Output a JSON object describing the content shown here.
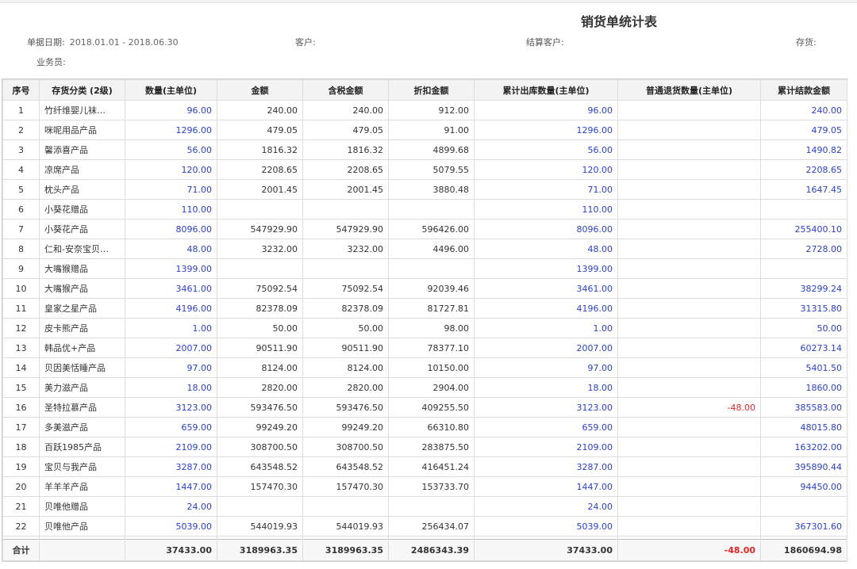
{
  "title": "销货单统计表",
  "filters": {
    "date_label": "单据日期:",
    "date_value": "2018.01.01 - 2018.06.30",
    "customer_label": "客户:",
    "settle_customer_label": "结算客户:",
    "inventory_label": "存货:",
    "salesperson_label": "业务员:"
  },
  "columns": [
    "序号",
    "存货分类 (2级)",
    "数量(主单位)",
    "金额",
    "含税金额",
    "折扣金额",
    "累计出库数量(主单位)",
    "普通退货数量(主单位)",
    "累计结款金额"
  ],
  "rows": [
    {
      "seq": "1",
      "category": "竹纤维婴儿袜…",
      "qty": "96.00",
      "amount": "240.00",
      "tax_amount": "240.00",
      "discount": "912.00",
      "out_qty": "96.00",
      "return_qty": "",
      "settled": "240.00"
    },
    {
      "seq": "2",
      "category": "咪呢用品产品",
      "qty": "1296.00",
      "amount": "479.05",
      "tax_amount": "479.05",
      "discount": "91.00",
      "out_qty": "1296.00",
      "return_qty": "",
      "settled": "479.05"
    },
    {
      "seq": "3",
      "category": "馨添喜产品",
      "qty": "56.00",
      "amount": "1816.32",
      "tax_amount": "1816.32",
      "discount": "4899.68",
      "out_qty": "56.00",
      "return_qty": "",
      "settled": "1490.82"
    },
    {
      "seq": "4",
      "category": "凉席产品",
      "qty": "120.00",
      "amount": "2208.65",
      "tax_amount": "2208.65",
      "discount": "5079.55",
      "out_qty": "120.00",
      "return_qty": "",
      "settled": "2208.65"
    },
    {
      "seq": "5",
      "category": "枕头产品",
      "qty": "71.00",
      "amount": "2001.45",
      "tax_amount": "2001.45",
      "discount": "3880.48",
      "out_qty": "71.00",
      "return_qty": "",
      "settled": "1647.45"
    },
    {
      "seq": "6",
      "category": "小葵花赠品",
      "qty": "110.00",
      "amount": "",
      "tax_amount": "",
      "discount": "",
      "out_qty": "110.00",
      "return_qty": "",
      "settled": ""
    },
    {
      "seq": "7",
      "category": "小葵花产品",
      "qty": "8096.00",
      "amount": "547929.90",
      "tax_amount": "547929.90",
      "discount": "596426.00",
      "out_qty": "8096.00",
      "return_qty": "",
      "settled": "255400.10"
    },
    {
      "seq": "8",
      "category": "仁和-安奈宝贝…",
      "qty": "48.00",
      "amount": "3232.00",
      "tax_amount": "3232.00",
      "discount": "4496.00",
      "out_qty": "48.00",
      "return_qty": "",
      "settled": "2728.00"
    },
    {
      "seq": "9",
      "category": "大嘴猴赠品",
      "qty": "1399.00",
      "amount": "",
      "tax_amount": "",
      "discount": "",
      "out_qty": "1399.00",
      "return_qty": "",
      "settled": ""
    },
    {
      "seq": "10",
      "category": "大嘴猴产品",
      "qty": "3461.00",
      "amount": "75092.54",
      "tax_amount": "75092.54",
      "discount": "92039.46",
      "out_qty": "3461.00",
      "return_qty": "",
      "settled": "38299.24"
    },
    {
      "seq": "11",
      "category": "皇家之星产品",
      "qty": "4196.00",
      "amount": "82378.09",
      "tax_amount": "82378.09",
      "discount": "81727.81",
      "out_qty": "4196.00",
      "return_qty": "",
      "settled": "31315.80"
    },
    {
      "seq": "12",
      "category": "皮卡熊产品",
      "qty": "1.00",
      "amount": "50.00",
      "tax_amount": "50.00",
      "discount": "98.00",
      "out_qty": "1.00",
      "return_qty": "",
      "settled": "50.00"
    },
    {
      "seq": "13",
      "category": "韩品优+产品",
      "qty": "2007.00",
      "amount": "90511.90",
      "tax_amount": "90511.90",
      "discount": "78377.10",
      "out_qty": "2007.00",
      "return_qty": "",
      "settled": "60273.14"
    },
    {
      "seq": "14",
      "category": "贝因美恬睡产品",
      "qty": "97.00",
      "amount": "8124.00",
      "tax_amount": "8124.00",
      "discount": "10150.00",
      "out_qty": "97.00",
      "return_qty": "",
      "settled": "5401.50"
    },
    {
      "seq": "15",
      "category": "美力滋产品",
      "qty": "18.00",
      "amount": "2820.00",
      "tax_amount": "2820.00",
      "discount": "2904.00",
      "out_qty": "18.00",
      "return_qty": "",
      "settled": "1860.00"
    },
    {
      "seq": "16",
      "category": "圣特拉慕产品",
      "qty": "3123.00",
      "amount": "593476.50",
      "tax_amount": "593476.50",
      "discount": "409255.50",
      "out_qty": "3123.00",
      "return_qty": "-48.00",
      "settled": "385583.00"
    },
    {
      "seq": "17",
      "category": "多美滋产品",
      "qty": "659.00",
      "amount": "99249.20",
      "tax_amount": "99249.20",
      "discount": "66310.80",
      "out_qty": "659.00",
      "return_qty": "",
      "settled": "48015.80"
    },
    {
      "seq": "18",
      "category": "百跃1985产品",
      "qty": "2109.00",
      "amount": "308700.50",
      "tax_amount": "308700.50",
      "discount": "283875.50",
      "out_qty": "2109.00",
      "return_qty": "",
      "settled": "163202.00"
    },
    {
      "seq": "19",
      "category": "宝贝与我产品",
      "qty": "3287.00",
      "amount": "643548.52",
      "tax_amount": "643548.52",
      "discount": "416451.24",
      "out_qty": "3287.00",
      "return_qty": "",
      "settled": "395890.44"
    },
    {
      "seq": "20",
      "category": "羊羊羊产品",
      "qty": "1447.00",
      "amount": "157470.30",
      "tax_amount": "157470.30",
      "discount": "153733.70",
      "out_qty": "1447.00",
      "return_qty": "",
      "settled": "94450.00"
    },
    {
      "seq": "21",
      "category": "贝唯他赠品",
      "qty": "24.00",
      "amount": "",
      "tax_amount": "",
      "discount": "",
      "out_qty": "24.00",
      "return_qty": "",
      "settled": ""
    },
    {
      "seq": "22",
      "category": "贝唯他产品",
      "qty": "5039.00",
      "amount": "544019.93",
      "tax_amount": "544019.93",
      "discount": "256434.07",
      "out_qty": "5039.00",
      "return_qty": "",
      "settled": "367301.60"
    }
  ],
  "total": {
    "label": "合计",
    "qty": "37433.00",
    "amount": "3189963.35",
    "tax_amount": "3189963.35",
    "discount": "2486343.39",
    "out_qty": "37433.00",
    "return_qty": "-48.00",
    "settled": "1860694.98"
  },
  "colors": {
    "link_blue": "#2a3fc7",
    "negative_red": "#e0262a",
    "header_bg": "#f3f3f3"
  }
}
